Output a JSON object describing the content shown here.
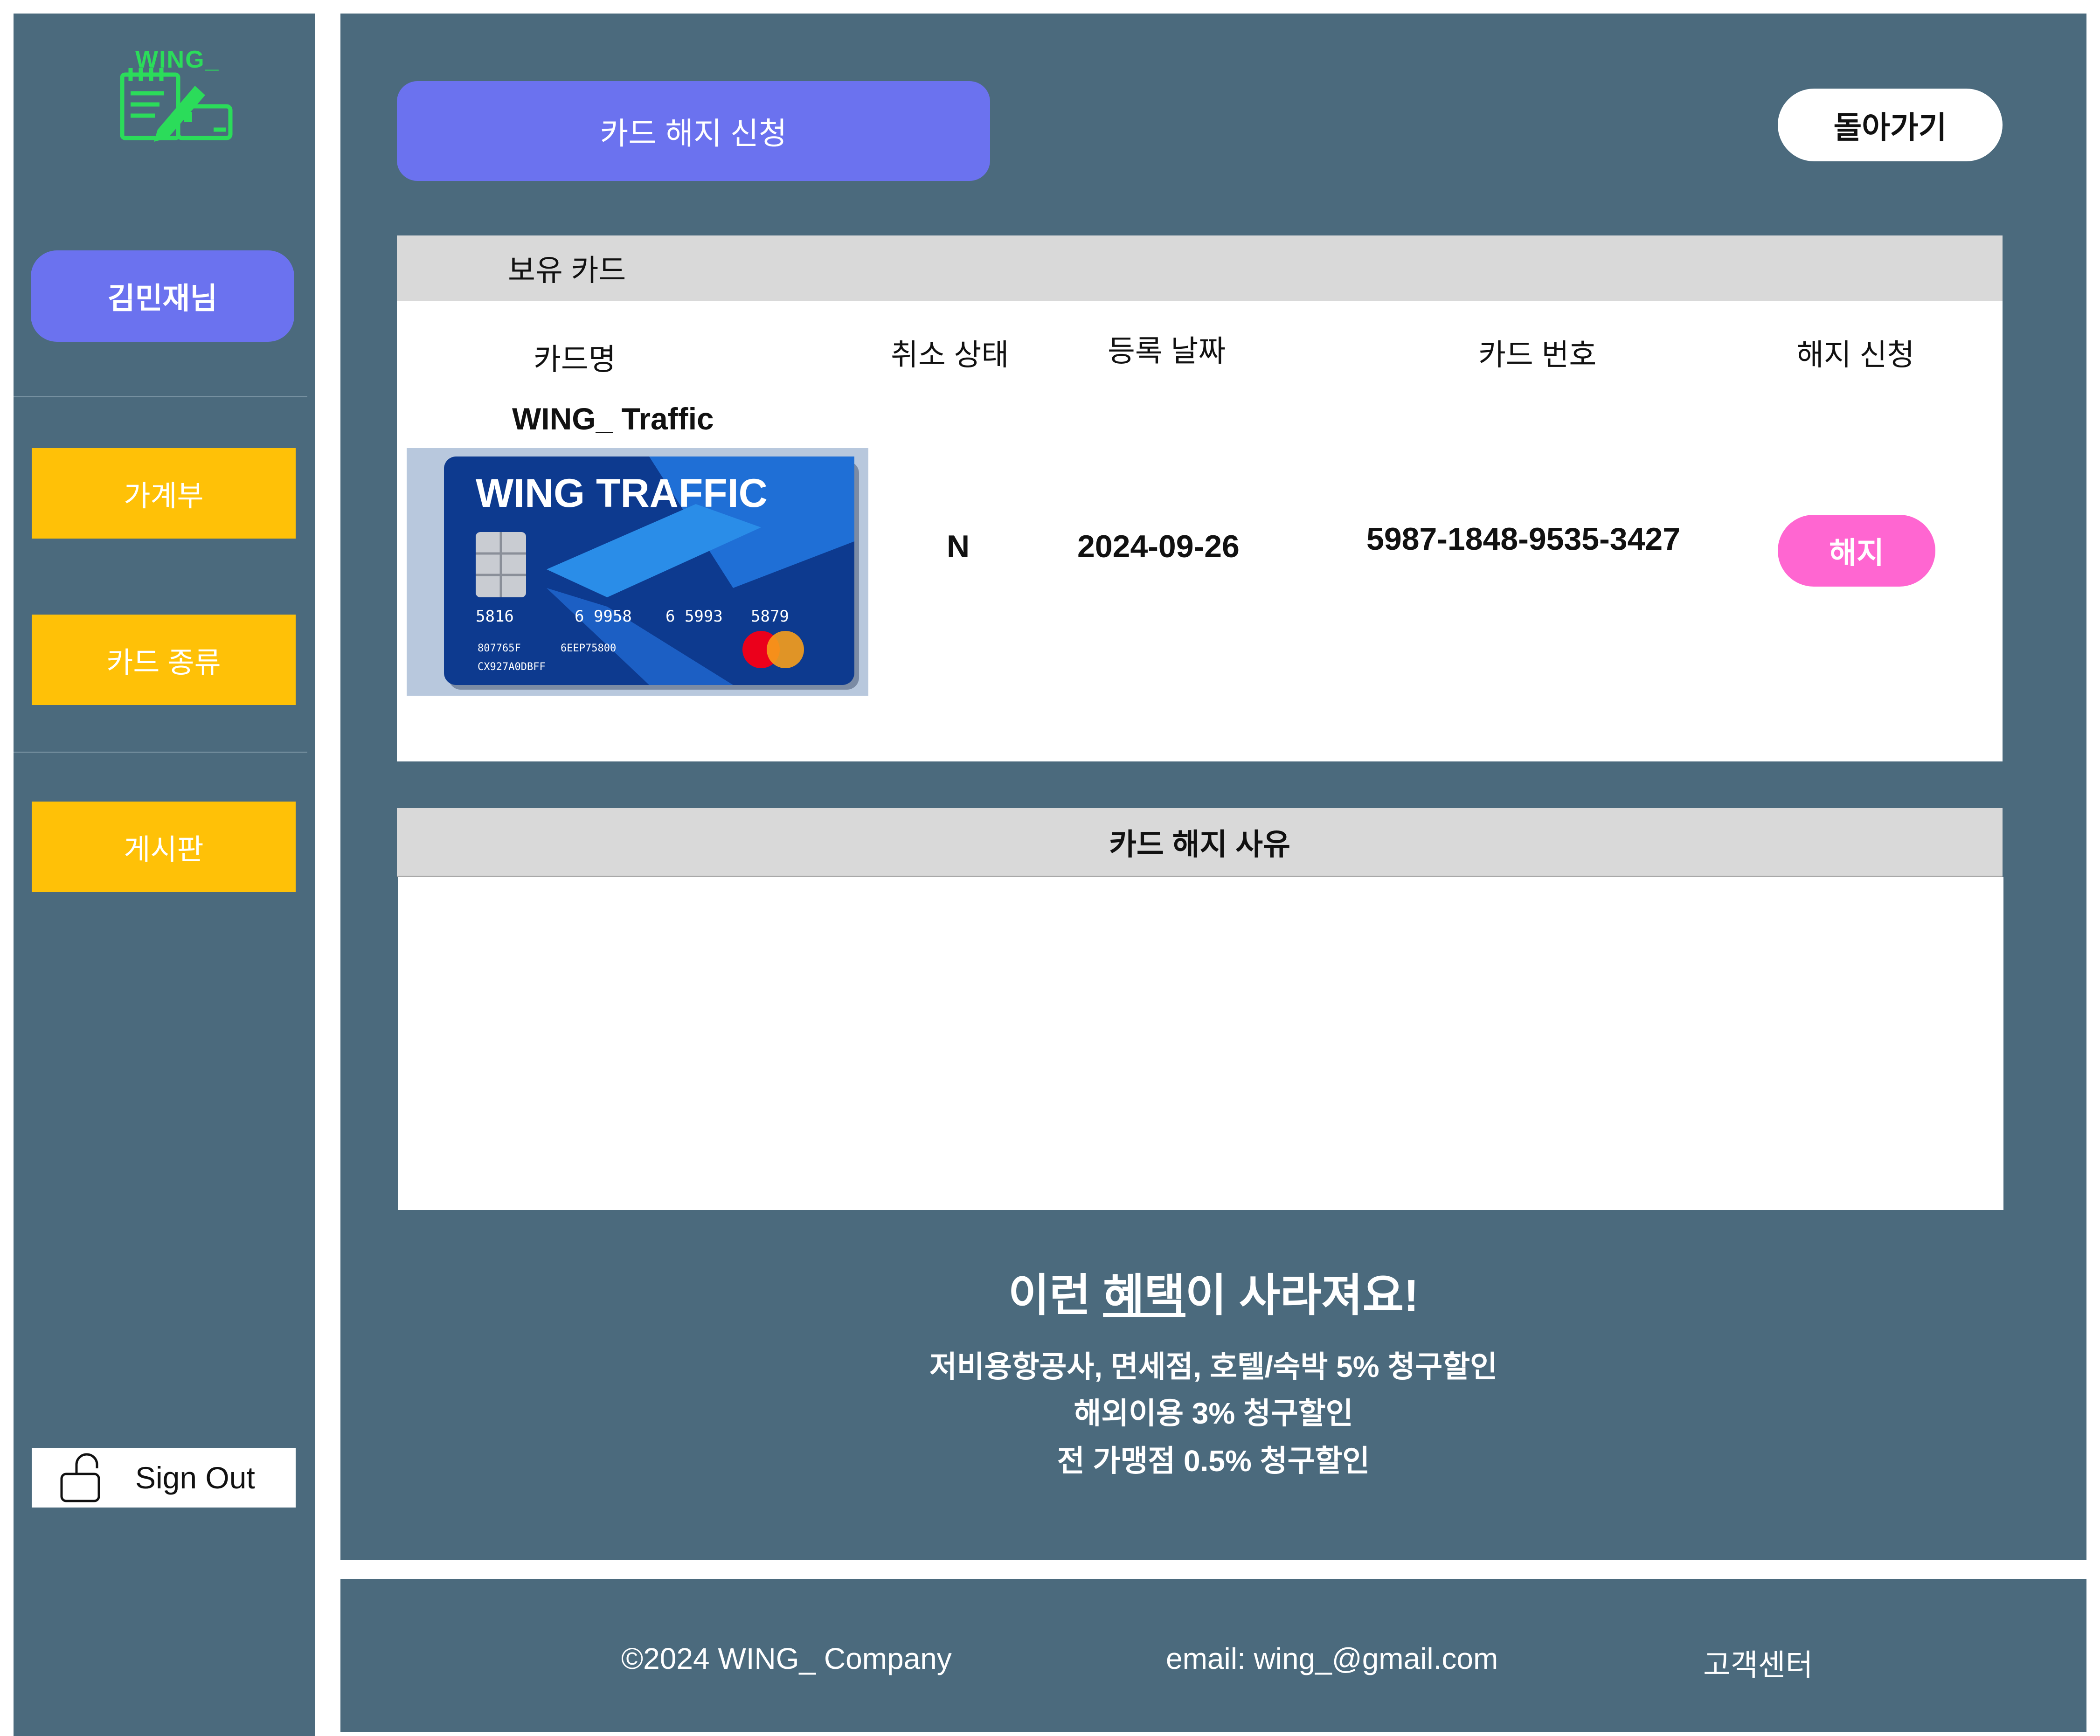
{
  "sidebar": {
    "logo_text": "WING_",
    "user_name": "김민재님",
    "nav": [
      "가계부",
      "카드 종류",
      "게시판"
    ],
    "sign_out": "Sign Out"
  },
  "header": {
    "title": "카드 해지 신청",
    "back": "돌아가기"
  },
  "owned_cards": {
    "section_label": "보유 카드",
    "columns": [
      "카드명",
      "취소 상태",
      "등록 날짜",
      "카드 번호",
      "해지 신청"
    ],
    "rows": [
      {
        "card_name": "WING_ Traffic",
        "cancel_status": "N",
        "registered_date": "2024-09-26",
        "card_number": "5987-1848-9535-3427",
        "action": "해지",
        "image": {
          "brand": "WING TRAFFIC",
          "numbers": [
            "5816",
            "6 9958",
            "6 5993",
            "5879"
          ],
          "line1a": "807765F",
          "line1b": "6EEP75800",
          "line2": "CX927A0DBFF"
        }
      }
    ]
  },
  "reason": {
    "label": "카드 해지 사유",
    "value": ""
  },
  "benefits": {
    "title_pre": "이런 ",
    "title_ul": "혜택",
    "title_post": "이 사라져요!",
    "lines": [
      "저비용항공사, 면세점, 호텔/숙박 5% 청구할인",
      "해외이용 3% 청구할인",
      "전 가맹점 0.5% 청구할인"
    ]
  },
  "footer": {
    "copyright": "©2024 WING_ Company",
    "email": "email: wing_@gmail.com",
    "support": "고객센터"
  },
  "colors": {
    "panel_bg": "#4b6a7d",
    "accent_purple": "#6b72ef",
    "nav_yellow": "#ffc107",
    "cancel_pink": "#ff66d1",
    "logo_green": "#2bdc5a"
  }
}
